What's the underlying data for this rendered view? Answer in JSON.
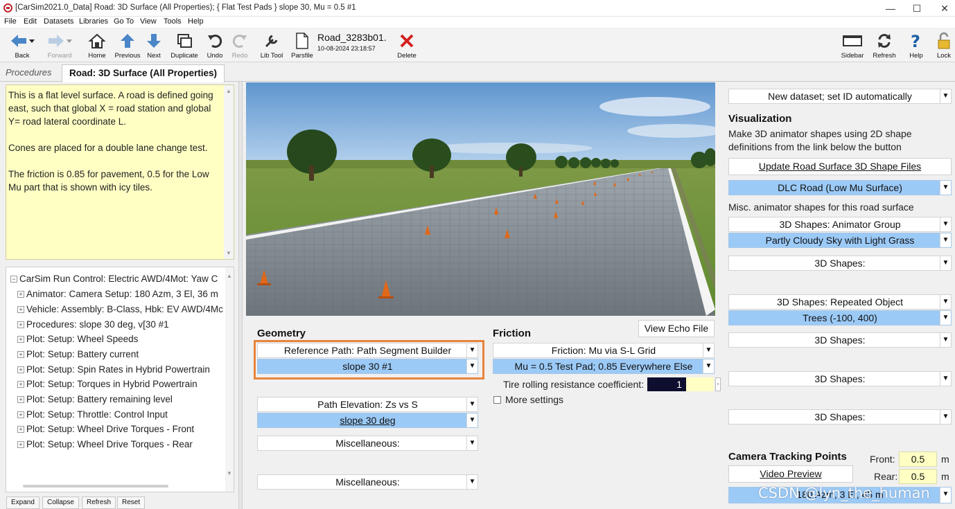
{
  "window": {
    "title": "[CarSim2021.0_Data] Road: 3D Surface (All Properties); { Flat Test Pads } slope 30, Mu = 0.5 #1",
    "minimize": "—",
    "maximize": "☐",
    "close": "✕"
  },
  "menu": [
    "File",
    "Edit",
    "Datasets",
    "Libraries",
    "Go To",
    "View",
    "Tools",
    "Help"
  ],
  "toolbar": {
    "back": "Back",
    "forward": "Forward",
    "home": "Home",
    "previous": "Previous",
    "next": "Next",
    "duplicate": "Duplicate",
    "undo": "Undo",
    "redo": "Redo",
    "lib_tool": "Lib Tool",
    "parsfile": "Parsfile",
    "dataset_name": "Road_3283b01.",
    "dataset_date": "10-08-2024 23:18:57",
    "delete": "Delete",
    "sidebar": "Sidebar",
    "refresh": "Refresh",
    "help": "Help",
    "lock": "Lock"
  },
  "tabs": {
    "procedures": "Procedures",
    "active": "Road: 3D Surface (All Properties)"
  },
  "notes": {
    "p1": "This is a flat level surface. A road is defined going east, such that global X = road station and global Y= road lateral coordinate L.",
    "p2": "Cones are placed for a double lane change test.",
    "p3": "The friction is 0.85 for pavement, 0.5 for the Low Mu part that is shown with icy tiles."
  },
  "tree": {
    "root": "CarSim Run Control: Electric AWD/4Mot: Yaw C",
    "items": [
      "Animator: Camera Setup: 180 Azm, 3 El, 36 m",
      "Vehicle: Assembly: B-Class, Hbk: EV AWD/4Mc",
      "Procedures: slope 30 deg, v[30 #1",
      "Plot: Setup: Wheel Speeds",
      "Plot: Setup: Battery current",
      "Plot: Setup: Spin Rates in Hybrid Powertrain",
      "Plot: Setup: Torques in Hybrid Powertrain",
      "Plot: Setup: Battery remaining level",
      "Plot: Setup: Throttle: Control Input",
      "Plot: Setup: Wheel Drive Torques - Front",
      "Plot: Setup: Wheel Drive Torques - Rear"
    ]
  },
  "tree_buttons": {
    "expand": "Expand",
    "collapse": "Collapse",
    "refresh": "Refresh",
    "reset": "Reset"
  },
  "geometry": {
    "title": "Geometry",
    "ref_path_type": "Reference Path: Path Segment Builder",
    "ref_path_value": "slope 30 #1",
    "elevation_type": "Path Elevation: Zs vs S",
    "elevation_value": "slope 30 deg",
    "misc1": "Miscellaneous:",
    "misc2": "Miscellaneous:"
  },
  "friction": {
    "view_echo": "View Echo File",
    "title": "Friction",
    "type": "Friction: Mu via S-L Grid",
    "value": "Mu = 0.5 Test Pad; 0.85 Everywhere Else",
    "rolling_label": "Tire rolling resistance coefficient:",
    "rolling_value": "1",
    "more_settings": "More settings"
  },
  "right": {
    "new_dataset": "New dataset; set ID automatically",
    "vis_title": "Visualization",
    "vis_desc1": "Make 3D animator shapes using 2D shape",
    "vis_desc2": "definitions from the link below the button",
    "update_btn": "Update Road Surface 3D Shape Files",
    "dlc_road": "DLC Road (Low Mu Surface)",
    "misc_label": "Misc. animator shapes for this road surface",
    "anim_group": "3D Shapes: Animator Group",
    "sky": "Partly Cloudy Sky with Light Grass",
    "shapes1": "3D Shapes:",
    "repeated": "3D Shapes: Repeated Object",
    "trees": "Trees (-100, 400)",
    "shapes2": "3D Shapes:",
    "shapes3": "3D Shapes:",
    "shapes4": "3D Shapes:",
    "camera_title": "Camera Tracking Points",
    "front_label": "Front:",
    "front_value": "0.5",
    "rear_label": "Rear:",
    "rear_value": "0.5",
    "unit": "m",
    "video_preview": "Video Preview",
    "camera_select": "180 Azm, 3 El, 45 m"
  },
  "watermark": "CSDN @lyn_the_human"
}
